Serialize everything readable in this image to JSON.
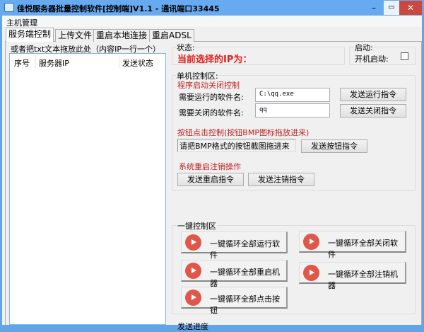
{
  "window": {
    "title": "佳悦服务器批量控制软件[控制端]V1.1 - 通讯端口33445",
    "minimize": "–",
    "maximize": "▭",
    "close": "✕"
  },
  "menu": {
    "items": [
      "主机管理"
    ]
  },
  "tabs": [
    "服务端控制",
    "上传文件",
    "重启本地连接",
    "重启ADSL"
  ],
  "left": {
    "drop_hint": "或者把txt文本拖放此处（内容IP一行一个）",
    "columns": [
      "序号",
      "服务器IP",
      "发送状态"
    ]
  },
  "status": {
    "label": "状态:",
    "current_ip": "当前选择的IP为："
  },
  "startup": {
    "label": "启动:",
    "autostart_label": "开机启动:",
    "autostart_checked": false
  },
  "single": {
    "label": "单机控制区:",
    "program_section": "程序启动关闭控制",
    "run_label": "需要运行的软件名:",
    "run_value": "C:\\qq.exe",
    "close_label": "需要关闭的软件名:",
    "close_value": "qq",
    "send_run": "发送运行指令",
    "send_close": "发送关闭指令",
    "button_section": "按钮点击控制(按钮BMP图标拖放进来)",
    "bmp_placeholder": "请把BMP格式的按钮截图拖进来",
    "send_button": "发送按钮指令",
    "system_section": "系统重启注销操作",
    "send_restart": "发送重启指令",
    "send_logoff": "发送注销指令"
  },
  "oneclick": {
    "label": "一键控制区",
    "buttons": [
      "一键循环全部运行软件",
      "一键循环全部关闭软件",
      "一键循环全部重启机器",
      "一键循环全部注销机器",
      "一键循环全部点击按钮"
    ],
    "icon": "play-icon",
    "icon_color": "#e0574a"
  },
  "progress": {
    "label": "发送进度"
  }
}
